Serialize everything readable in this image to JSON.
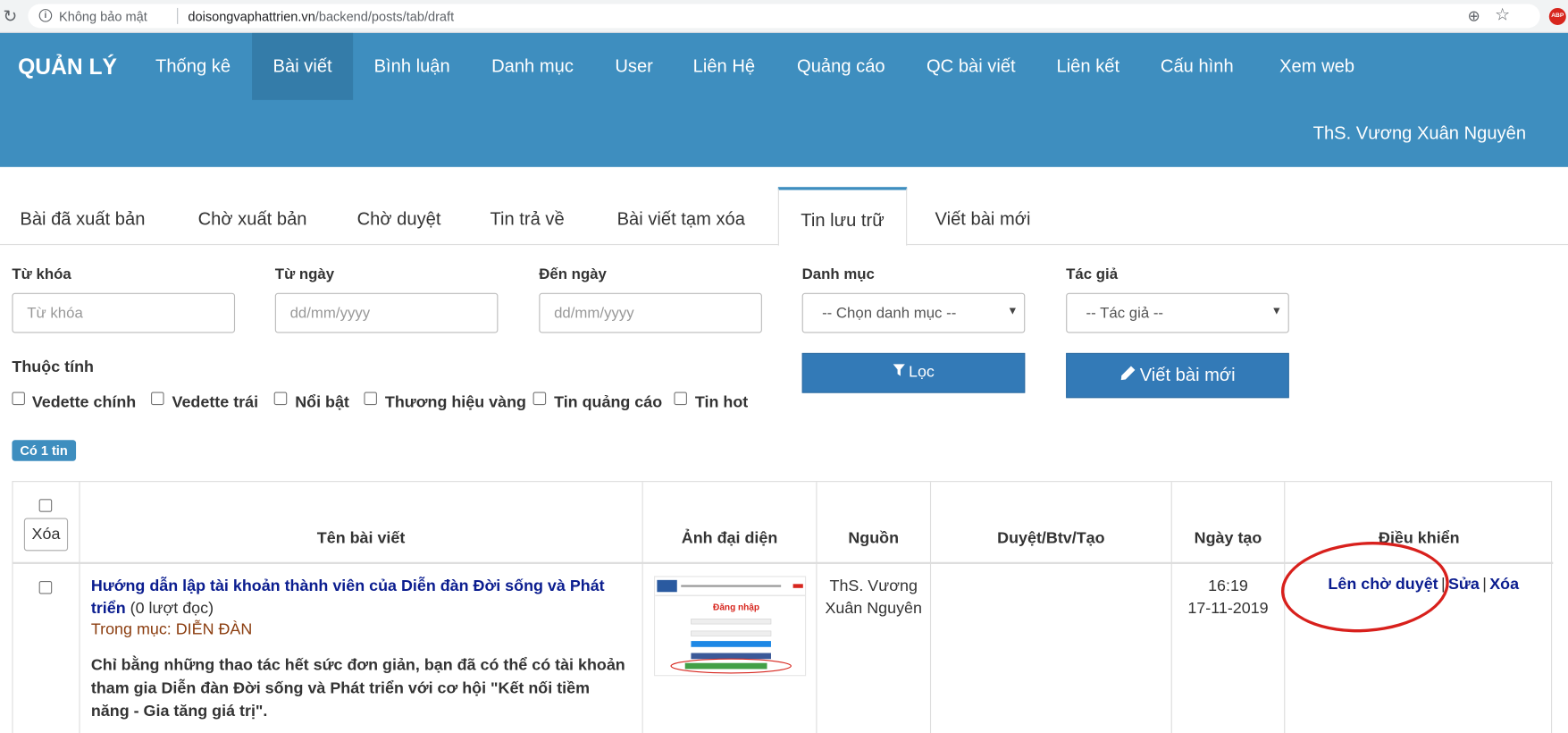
{
  "browser": {
    "security_text": "Không bảo mật",
    "url_host": "doisongvaphattrien.vn",
    "url_path": "/backend/posts/tab/draft",
    "abp_label": "ABP"
  },
  "navbar": {
    "brand": "QUẢN LÝ",
    "items": [
      "Thống kê",
      "Bài viết",
      "Bình luận",
      "Danh mục",
      "User",
      "Liên Hệ",
      "Quảng cáo",
      "QC bài viết",
      "Liên kết",
      "Cấu hình",
      "Xem web"
    ],
    "active_index": 1,
    "username": "ThS. Vương Xuân Nguyên"
  },
  "tabs": {
    "items": [
      "Bài đã xuất bản",
      "Chờ xuất bản",
      "Chờ duyệt",
      "Tin trả về",
      "Bài viết tạm xóa",
      "Tin lưu trữ",
      "Viết bài mới"
    ],
    "active_index": 5
  },
  "filters": {
    "keyword_label": "Từ khóa",
    "keyword_placeholder": "Từ khóa",
    "from_label": "Từ ngày",
    "from_placeholder": "dd/mm/yyyy",
    "to_label": "Đến ngày",
    "to_placeholder": "dd/mm/yyyy",
    "category_label": "Danh mục",
    "category_selected": "-- Chọn danh mục --",
    "author_label": "Tác giả",
    "author_selected": "-- Tác giả --",
    "attributes_label": "Thuộc tính",
    "attributes": [
      "Vedette chính",
      "Vedette trái",
      "Nổi bật",
      "Thương hiệu vàng",
      "Tin quảng cáo",
      "Tin hot"
    ],
    "filter_button": "Lọc",
    "new_post_button": "Viết bài mới"
  },
  "count_badge": "Có 1 tin",
  "table": {
    "delete_button": "Xóa",
    "headers": [
      "Tên bài viết",
      "Ảnh đại diện",
      "Nguồn",
      "Duyệt/Btv/Tạo",
      "Ngày tạo",
      "Điều khiển"
    ],
    "rows": [
      {
        "title": "Hướng dẫn lập tài khoản thành viên của Diễn đàn Đời sống và Phát triển",
        "views": "(0 lượt đọc)",
        "category": "Trong mục: DIỄN ĐÀN",
        "summary": "Chỉ bằng những thao tác hết sức đơn giản, bạn đã có thể có tài khoản tham gia Diễn đàn Đời sống và Phát triển với cơ hội \"Kết nối tiềm năng - Gia tăng giá trị\".",
        "source": "ThS. Vương Xuân Nguyên",
        "approval": "",
        "created_time": "16:19",
        "created_date": "17-11-2019",
        "actions": [
          "Lên chờ duyệt",
          "Sửa",
          "Xóa"
        ],
        "thumbnail_text": "Đăng nhập"
      }
    ]
  },
  "colors": {
    "navbar": "#3e8ebf",
    "navbar_active": "#347ca9",
    "primary_button": "#337ab7",
    "link": "#0b1d8f",
    "category": "#8b3d0f",
    "annotation_circle": "#d8201c"
  }
}
